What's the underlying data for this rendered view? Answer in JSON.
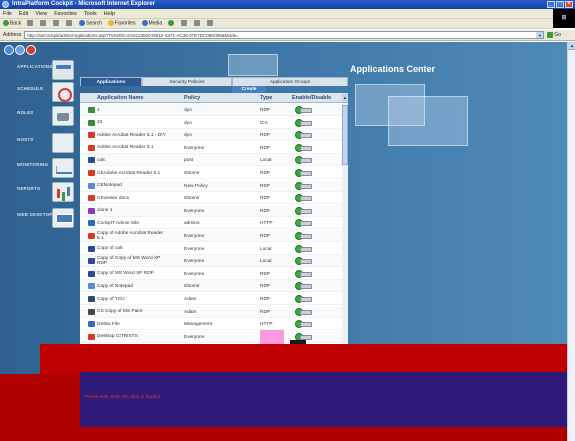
{
  "window": {
    "title": "IntraPlatform Cockpit - Microsoft Internet Explorer",
    "controls": [
      "_",
      "□",
      "×"
    ]
  },
  "menu": [
    "File",
    "Edit",
    "View",
    "Favorites",
    "Tools",
    "Help"
  ],
  "toolbar": {
    "back": "Back",
    "search": "Search",
    "favorites": "Favorites",
    "media": "Media"
  },
  "address": {
    "label": "Address",
    "url": "http://ss/cockpit/admin/Applications.asp?TicketID=D15123920-DB12-4371-AC36-07E7DC08D095&Mode=",
    "go": "Go"
  },
  "nav": [
    {
      "label": "APPLICATIONS",
      "icon": "apps"
    },
    {
      "label": "SCHEDULE",
      "icon": "sched"
    },
    {
      "label": "ROLES",
      "icon": "role"
    },
    {
      "label": "HOSTS",
      "icon": "host"
    },
    {
      "label": "MONITORING",
      "icon": "mon"
    },
    {
      "label": "REPORTS",
      "icon": "rep"
    },
    {
      "label": "WEB DESKTOP",
      "icon": "desk"
    }
  ],
  "page_title": "Applications Center",
  "tabs": [
    "Applications",
    "Security Policies",
    "Application Groups"
  ],
  "create_label": "Create",
  "columns": [
    "Application Name",
    "Policy",
    "Type",
    "Enable/Disable"
  ],
  "rows": [
    {
      "name": "1",
      "policy": "dyo",
      "type": "RDP",
      "icon": "#3c8a3c"
    },
    {
      "name": "22",
      "policy": "dyo",
      "type": "ICA",
      "icon": "#3c8a3c"
    },
    {
      "name": "Adobe Acrobat Reader 5.1 - DIY",
      "policy": "dyo",
      "type": "RDP",
      "icon": "#d83a2a"
    },
    {
      "name": "Adobe Acrobat Reader 5.1",
      "policy": "Everyone",
      "type": "RDP",
      "icon": "#d83a2a"
    },
    {
      "name": "calc",
      "policy": "post",
      "type": "Local",
      "icon": "#2a4a98"
    },
    {
      "name": "CEAdobe Acrobat Reader 5.1",
      "policy": "shlomir",
      "type": "RDP",
      "icon": "#d83a2a"
    },
    {
      "name": "CENotepad",
      "policy": "New Policy",
      "type": "RDP",
      "icon": "#5a8ad8"
    },
    {
      "name": "CEviewer docs",
      "policy": "shlomir",
      "type": "RDP",
      "icon": "#d83a2a"
    },
    {
      "name": "clone 1",
      "policy": "Everyone",
      "type": "RDP",
      "icon": "#8a3ab8"
    },
    {
      "name": "CockpIT Admin Site",
      "policy": "admins",
      "type": "HTTP",
      "icon": "#2a6ab8"
    },
    {
      "name": "Copy of Adobe Acrobat Reader 5.1",
      "policy": "Everyone",
      "type": "RDP",
      "icon": "#d83a2a"
    },
    {
      "name": "Copy of calc",
      "policy": "Everyone",
      "type": "Local",
      "icon": "#2a4a98"
    },
    {
      "name": "Copy of Copy of MS Word XP RDP",
      "policy": "Everyone",
      "type": "Local",
      "icon": "#2a4a98"
    },
    {
      "name": "Copy of MS Word XP RDP",
      "policy": "Everyone",
      "type": "RDP",
      "icon": "#2a4a98"
    },
    {
      "name": "Copy of Notepad",
      "policy": "shlomir",
      "type": "RDP",
      "icon": "#5a8ad8"
    },
    {
      "name": "Copy of TCU",
      "policy": "Adam",
      "type": "RDP",
      "icon": "#2a4a78"
    },
    {
      "name": "CS Copy of MS Paint",
      "policy": "Adam",
      "type": "RDP",
      "icon": "#4a4a4a"
    },
    {
      "name": "Deska File",
      "policy": "Management",
      "type": "HTTP",
      "icon": "#3a6ab8"
    },
    {
      "name": "Desktop CITRIXTS",
      "policy": "Everyone",
      "type": "RDP",
      "icon": "#d83a2a"
    }
  ],
  "footer_text": "Please wait while the data is loaded..."
}
